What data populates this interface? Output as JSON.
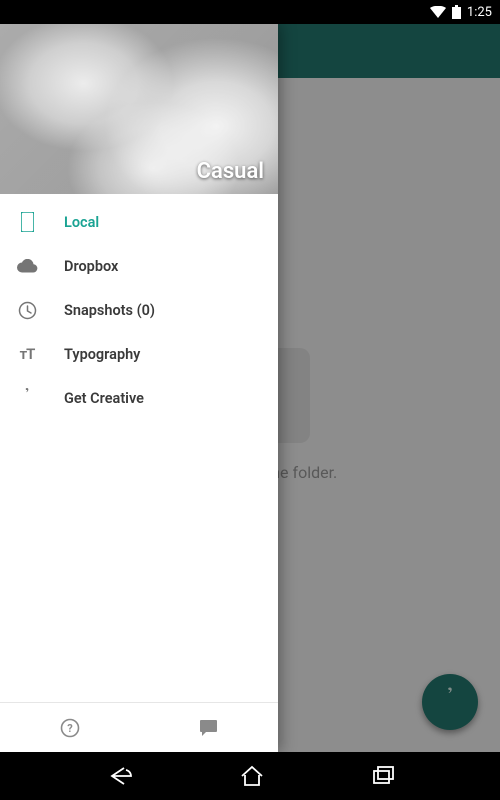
{
  "status": {
    "time": "1:25"
  },
  "drawer": {
    "title": "Casual",
    "items": [
      {
        "icon": "phone-icon",
        "label": "Local",
        "active": true
      },
      {
        "icon": "cloud-icon",
        "label": "Dropbox",
        "active": false
      },
      {
        "icon": "history-icon",
        "label": "Snapshots (0)",
        "active": false
      },
      {
        "icon": "type-icon",
        "label": "Typography",
        "active": false
      },
      {
        "icon": "quote-icon",
        "label": "Get Creative",
        "active": false
      }
    ]
  },
  "main": {
    "empty_text": "This is your home folder."
  }
}
